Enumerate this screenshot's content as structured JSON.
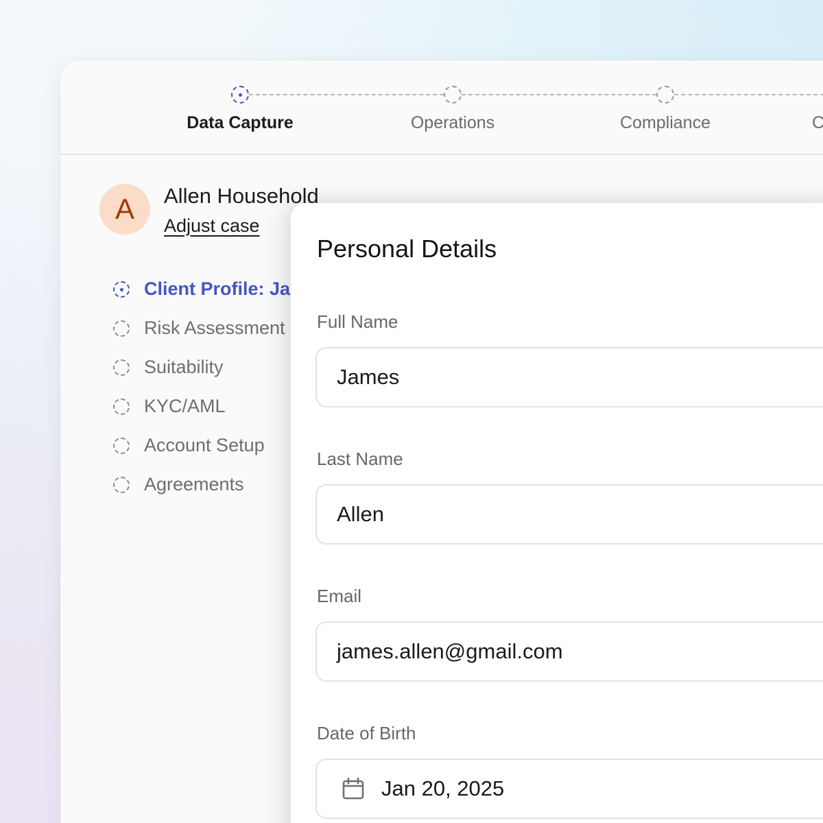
{
  "stepper": {
    "steps": [
      {
        "label": "Data Capture",
        "state": "active"
      },
      {
        "label": "Operations",
        "state": "pending"
      },
      {
        "label": "Compliance",
        "state": "pending"
      },
      {
        "label": "C",
        "state": "pending"
      }
    ]
  },
  "client": {
    "avatar_initial": "A",
    "household_name": "Allen Household",
    "adjust_link": "Adjust case"
  },
  "nav": {
    "items": [
      {
        "label": "Client Profile: Ja",
        "state": "active"
      },
      {
        "label": "Risk Assessment",
        "state": "pending"
      },
      {
        "label": "Suitability",
        "state": "pending"
      },
      {
        "label": "KYC/AML",
        "state": "pending"
      },
      {
        "label": "Account Setup",
        "state": "pending"
      },
      {
        "label": "Agreements",
        "state": "pending"
      }
    ]
  },
  "form": {
    "title": "Personal Details",
    "full_name": {
      "label": "Full Name",
      "value": "James"
    },
    "last_name": {
      "label": "Last Name",
      "value": "Allen"
    },
    "email": {
      "label": "Email",
      "value": "james.allen@gmail.com"
    },
    "dob": {
      "label": "Date of Birth",
      "value": "Jan 20, 2025",
      "icon": "calendar-icon"
    }
  },
  "colors": {
    "accent": "#4356c2",
    "avatar_bg": "#fbdcc8",
    "avatar_text": "#a13a08"
  }
}
